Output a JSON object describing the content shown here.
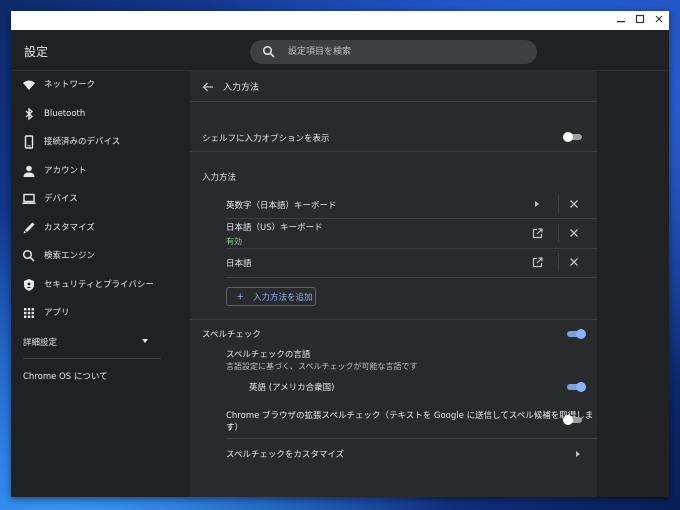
{
  "window": {
    "minimize_icon": "minimize-icon",
    "maximize_icon": "maximize-icon",
    "close_icon": "close-icon"
  },
  "app": {
    "title": "設定"
  },
  "search": {
    "placeholder": "設定項目を検索",
    "icon": "search-icon"
  },
  "sidebar": {
    "items": [
      {
        "label": "ネットワーク",
        "icon": "wifi-icon"
      },
      {
        "label": "Bluetooth",
        "icon": "bluetooth-icon"
      },
      {
        "label": "接続済みのデバイス",
        "icon": "phone-icon"
      },
      {
        "label": "アカウント",
        "icon": "person-icon"
      },
      {
        "label": "デバイス",
        "icon": "laptop-icon"
      },
      {
        "label": "カスタマイズ",
        "icon": "pen-icon"
      },
      {
        "label": "検索エンジン",
        "icon": "search-icon"
      },
      {
        "label": "セキュリティとプライバシー",
        "icon": "shield-icon"
      },
      {
        "label": "アプリ",
        "icon": "apps-grid-icon"
      }
    ],
    "advanced_label": "詳細設定",
    "about_label": "Chrome OS について"
  },
  "page": {
    "title": "入力方法",
    "shelf_option": {
      "label": "シェルフに入力オプションを表示",
      "enabled": false
    },
    "input_methods_header": "入力方法",
    "input_methods": [
      {
        "label": "英数字（日本語）キーボード",
        "status": ""
      },
      {
        "label": "日本語（US）キーボード",
        "status": "有効"
      },
      {
        "label": "日本語",
        "status": ""
      }
    ],
    "add_button_label": "入力方法を追加",
    "spellcheck": {
      "label": "スペルチェック",
      "enabled": true,
      "languages_label": "スペルチェックの言語",
      "languages_sub": "言語設定に基づく、スペルチェックが可能な言語です",
      "language_item": {
        "label": "英語 (アメリカ合衆国)",
        "enabled": true
      },
      "enhanced": {
        "label_line1": "Chrome ブラウザの拡張スペルチェック（テキストを Google に送信してスペル候補を取得します",
        "label_line2": "す）",
        "enabled": false
      },
      "customize_label": "スペルチェックをカスタマイズ"
    }
  },
  "colors": {
    "accent": "#8ab4f8",
    "status_green": "#81c995",
    "surface": "#292a2d",
    "background": "#202124"
  }
}
